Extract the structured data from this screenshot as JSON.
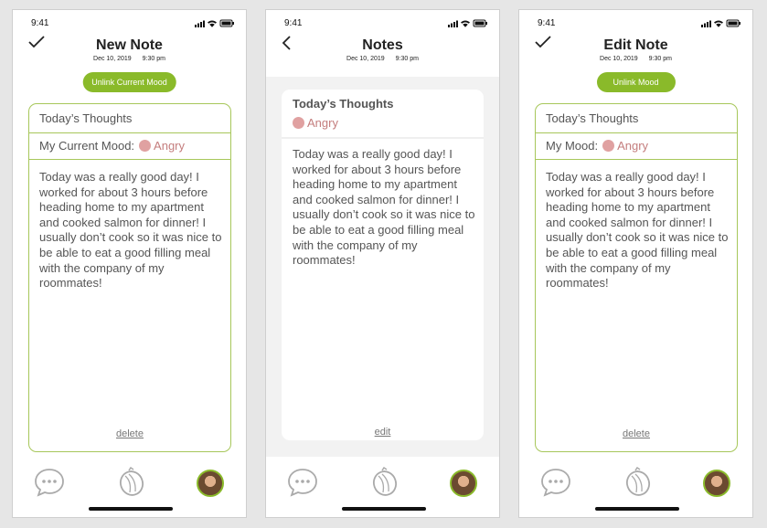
{
  "status": {
    "time": "9:41"
  },
  "screens": [
    {
      "title": "New Note",
      "date": "Dec 10, 2019",
      "time": "9:30 pm",
      "pill": "Unlink Current Mood",
      "card_title": "Today’s Thoughts",
      "mood_label": "My Current Mood:",
      "mood_value": "Angry",
      "body": "Today was a really good day! I worked for about 3 hours before heading home to my apartment and cooked salmon for dinner! I usually don’t cook so it was nice to be able to eat a good filling meal with the company of my roommates!",
      "link": "delete"
    },
    {
      "title": "Notes",
      "date": "Dec 10, 2019",
      "time": "9:30 pm",
      "card_title": "Today’s Thoughts",
      "mood_value": "Angry",
      "body": "Today was a really good day! I worked for about 3 hours before heading home to my apartment and cooked salmon for dinner! I usually don’t cook so it was nice to be able to eat a good filling meal with the company of my roommates!",
      "link": "edit"
    },
    {
      "title": "Edit Note",
      "date": "Dec 10, 2019",
      "time": "9:30 pm",
      "pill": "Unlink Mood",
      "card_title": "Today’s Thoughts",
      "mood_label": "My Mood:",
      "mood_value": "Angry",
      "body": "Today was a really good day! I worked for about 3 hours before heading home to my apartment and cooked salmon for dinner! I usually don’t cook so it was nice to be able to eat a good filling meal with the company of my roommates!",
      "link": "delete"
    }
  ],
  "colors": {
    "accent": "#8aba2a",
    "mood_dot": "#e0a1a1",
    "mood_text": "#c47d7d"
  },
  "nav_icons": [
    "chat-bubble-icon",
    "lemon-icon",
    "profile-avatar"
  ]
}
